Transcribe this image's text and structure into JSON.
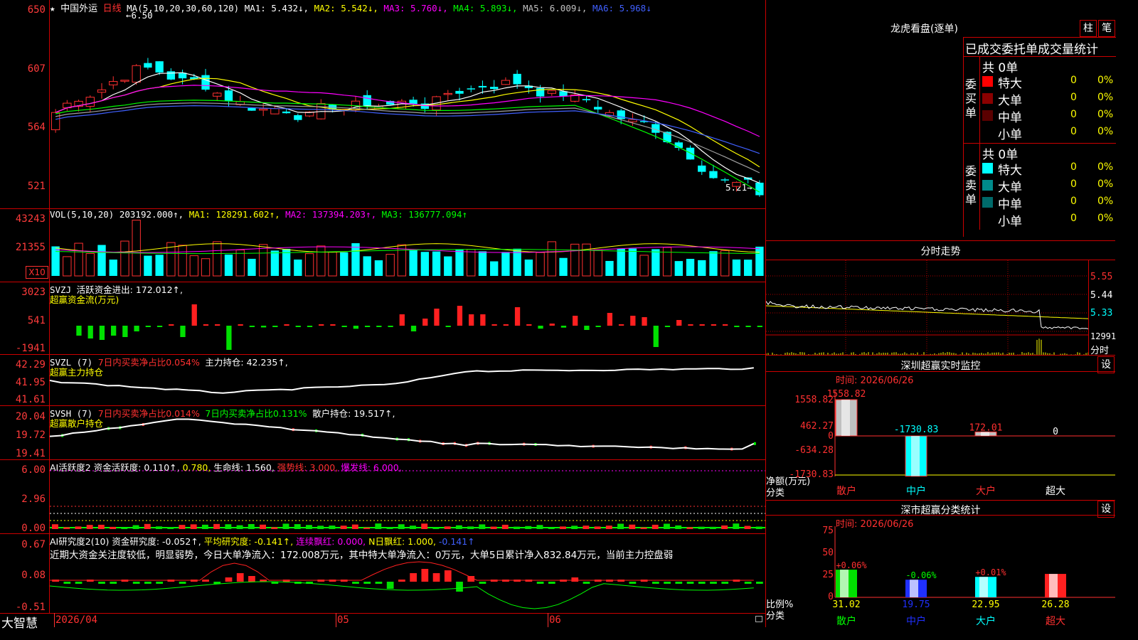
{
  "header": {
    "star": "★",
    "stock_name": "中国外运",
    "period": "日线",
    "ma_label": "MA(5,10,20,30,60,120)",
    "ma1": "MA1: 5.432↓,",
    "ma2": "MA2: 5.542↓,",
    "ma3": "MA3: 5.760↓,",
    "ma4": "MA4: 5.893↓,",
    "ma5": "MA5: 6.009↓,",
    "ma6": "MA6: 5.968↓",
    "high_marker": "←6.50",
    "low_marker": "5.21→"
  },
  "price_axis": [
    "650",
    "607",
    "564",
    "521"
  ],
  "vol": {
    "title": "VOL(5,10,20)",
    "value": "203192.000↑,",
    "ma1": "MA1: 128291.602↑,",
    "ma2": "MA2: 137394.203↑,",
    "ma3": "MA3: 136777.094↑",
    "axis": [
      "43243",
      "21355"
    ],
    "unit": "X10"
  },
  "svzj": {
    "title": "SVZJ",
    "label": "活跃资金进出: 172.012↑,",
    "subtitle": "超赢资金流(万元)",
    "axis": [
      "3023",
      "541",
      "-1941"
    ]
  },
  "svzl": {
    "title": "SVZL (7)",
    "label1": "7日内买卖净占比0.054%",
    "label2": "主力持仓: 42.235↑,",
    "subtitle": "超赢主力持仓",
    "axis": [
      "42.29",
      "41.95",
      "41.61"
    ]
  },
  "svsh": {
    "title": "SVSH (7)",
    "label1": "7日内买卖净占比0.014%",
    "label2": "7日内买卖净占比0.131%",
    "label3": "散户持仓: 19.517↑,",
    "subtitle": "超赢散户持仓",
    "axis": [
      "20.04",
      "19.72",
      "19.41"
    ]
  },
  "ai_active": {
    "title": "AI活跃度2",
    "label1": "资金活跃度: 0.110↑,",
    "label2": "0.780,",
    "label3": "生命线: 1.560,",
    "label4": "强势线: 3.000,",
    "label5": "爆发线: 6.000,",
    "axis": [
      "6.00",
      "2.96",
      "0.00"
    ]
  },
  "ai_research": {
    "title": "AI研究度2(10)",
    "label1": "资金研究度: -0.052↑,",
    "label2": "平均研究度: -0.141↑,",
    "label3": "连续飘红: 0.000,",
    "label4": "N日飘红: 1.000,",
    "label5": "-0.141↑",
    "comment": "近期大资金关注度较低，明显弱势，今日大单净流入：172.008万元，其中特大单净流入：0万元，大单5日累计净入832.84万元，当前主力控盘弱",
    "axis": [
      "0.67",
      "0.08",
      "-0.51"
    ]
  },
  "date_axis": {
    "brand": "大智慧",
    "labels": [
      "2026/04",
      "05",
      "06"
    ]
  },
  "longhu": {
    "title": "龙虎看盘(逐单)",
    "btn_bar": "柱",
    "btn_pen": "笔",
    "subtitle": "已成交委托单成交量统计",
    "buy_group": "委买单",
    "buy_total": "共 0单",
    "sell_group": "委卖单",
    "sell_total": "共 0单",
    "buy_rows": [
      {
        "name": "特大",
        "count": "0",
        "pct": "0%",
        "color": "#ff0000"
      },
      {
        "name": "大单",
        "count": "0",
        "pct": "0%",
        "color": "#8b0000"
      },
      {
        "name": "中单",
        "count": "0",
        "pct": "0%",
        "color": "#5a0000"
      },
      {
        "name": "小单",
        "count": "0",
        "pct": "0%",
        "color": "#000000"
      }
    ],
    "sell_rows": [
      {
        "name": "特大",
        "count": "0",
        "pct": "0%",
        "color": "#00ffff"
      },
      {
        "name": "大单",
        "count": "0",
        "pct": "0%",
        "color": "#008b8b"
      },
      {
        "name": "中单",
        "count": "0",
        "pct": "0%",
        "color": "#006a6a"
      },
      {
        "name": "小单",
        "count": "0",
        "pct": "0%",
        "color": "#000000"
      }
    ]
  },
  "intraday": {
    "title": "分时走势",
    "axis": [
      "5.55",
      "5.44",
      "5.33"
    ],
    "vol_label": "12991",
    "unit": "分时"
  },
  "sz_monitor": {
    "title": "深圳超赢实时监控",
    "btn": "设",
    "time": "时间: 2026/06/26",
    "axis": [
      "1558.82",
      "462.27",
      "0",
      "-634.28",
      "-1730.83"
    ],
    "axis_title": "净额(万元)",
    "category_title": "分类",
    "bars": [
      {
        "name": "散户",
        "value": "1558.82"
      },
      {
        "name": "中户",
        "value": "-1730.83"
      },
      {
        "name": "大户",
        "value": "172.01"
      },
      {
        "name": "超大",
        "value": "0"
      }
    ]
  },
  "sz_class": {
    "title": "深市超赢分类统计",
    "btn": "设",
    "time": "时间: 2026/06/26",
    "axis": [
      "75",
      "50",
      "25",
      "0"
    ],
    "axis_title": "比例%",
    "category_title": "分类",
    "bars": [
      {
        "name": "散户",
        "pct": "31.02",
        "delta": "+0.06%"
      },
      {
        "name": "中户",
        "pct": "19.75",
        "delta": "-0.06%"
      },
      {
        "name": "大户",
        "pct": "22.95",
        "delta": "+0.01%"
      },
      {
        "name": "超大",
        "pct": "26.28",
        "delta": ""
      }
    ]
  },
  "colors": {
    "up": "#ff3030",
    "down": "#00ffff",
    "border": "#cc0000",
    "ma1": "#ffffff",
    "ma2": "#ffff00",
    "ma3": "#ff00ff",
    "ma4": "#00ff00",
    "ma5": "#a0a0a0",
    "ma6": "#4060ff"
  }
}
